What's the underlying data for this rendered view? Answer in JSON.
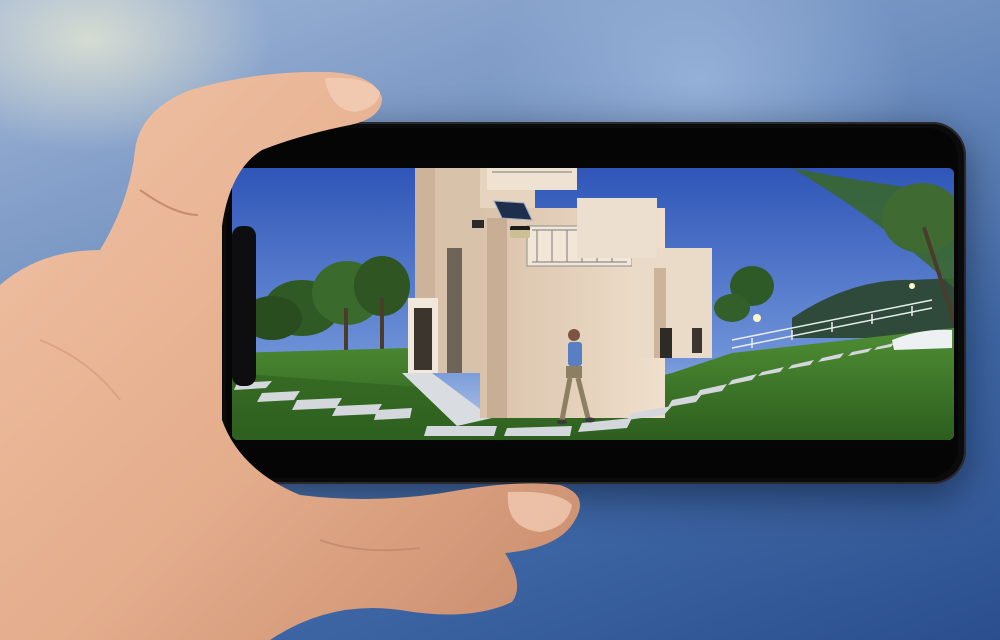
{
  "scene": {
    "colors": {
      "sky_top": "#2f56b8",
      "sky_bottom": "#9db7e6",
      "lawn": "#3f7d2a",
      "lawn_dark": "#2d5e1e",
      "house_wall": "#e9d7c2",
      "house_shadow": "#cdb39a",
      "stone": "#cfd3d8",
      "skin": "#e8b494"
    },
    "icons": [
      "phone",
      "hand",
      "house",
      "person",
      "tree",
      "solar-panel",
      "security-light"
    ]
  }
}
